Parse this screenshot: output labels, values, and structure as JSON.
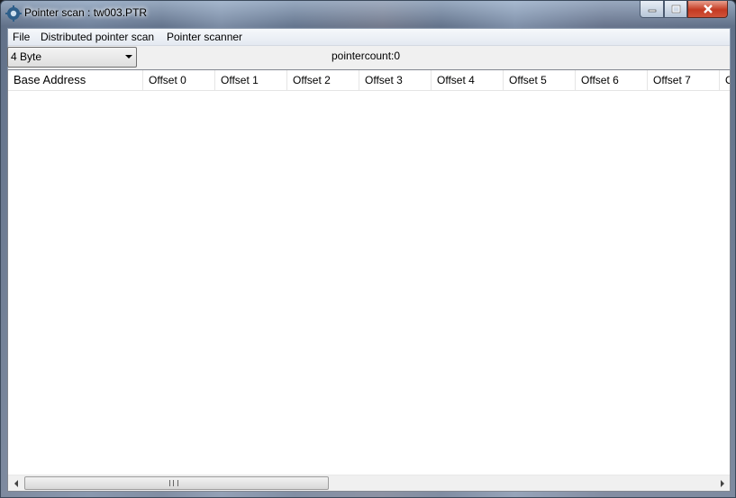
{
  "window": {
    "title": "Pointer scan : tw003.PTR",
    "app_icon": "cheat-engine-gear-icon",
    "controls": [
      "minimize-icon",
      "maximize-icon",
      "close-icon"
    ]
  },
  "menubar": {
    "items": [
      "File",
      "Distributed pointer scan",
      "Pointer scanner"
    ]
  },
  "toolbar": {
    "value_type": "4 Byte",
    "pointer_count": "pointercount:0"
  },
  "results_table": {
    "columns": [
      "Base Address",
      "Offset 0",
      "Offset 1",
      "Offset 2",
      "Offset 3",
      "Offset 4",
      "Offset 5",
      "Offset 6",
      "Offset 7",
      "O"
    ],
    "rows": []
  },
  "scrollbar": {
    "grip_label": "III"
  }
}
